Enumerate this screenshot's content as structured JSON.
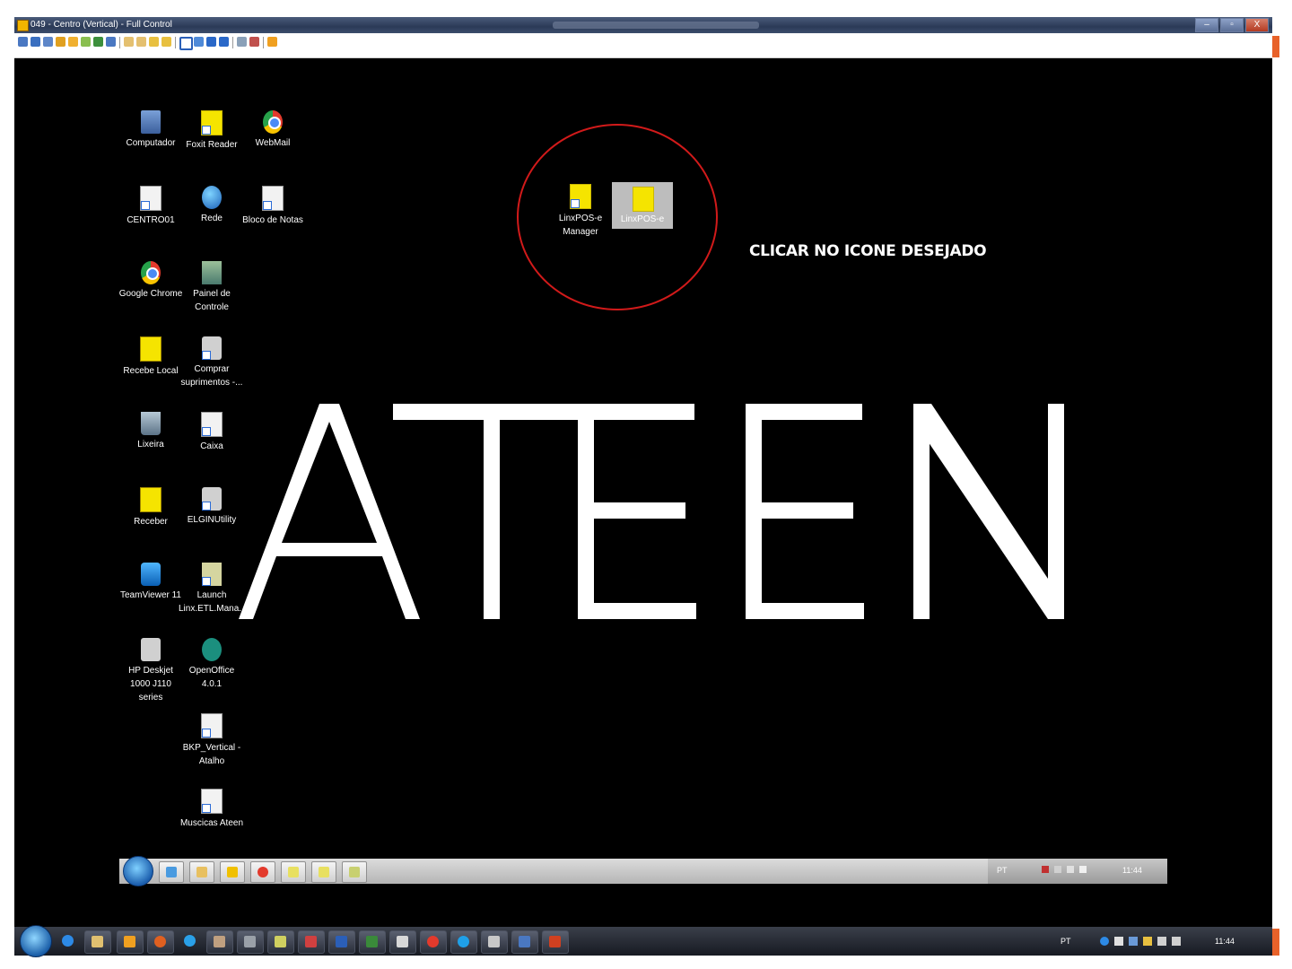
{
  "window": {
    "title": "049 - Centro (Vertical) - Full Control",
    "controls": {
      "minimize": "–",
      "maximize": "▫",
      "close": "X"
    }
  },
  "toolbar": {
    "buttons": [
      "pc",
      "monitor",
      "display",
      "arrows",
      "refresh",
      "transfer",
      "phone",
      "chat",
      "user1",
      "user2",
      "lock1",
      "lock2",
      "window",
      "screens",
      "blue1",
      "blue2",
      "gear",
      "tools",
      "close"
    ]
  },
  "desktop": {
    "icons": [
      {
        "label": "Computador",
        "icon": "computer-icon"
      },
      {
        "label": "Foxit Reader",
        "icon": "pdf-reader-icon"
      },
      {
        "label": "WebMail",
        "icon": "chrome-icon"
      },
      {
        "label": "CENTRO01",
        "icon": "file-icon"
      },
      {
        "label": "Rede",
        "icon": "network-icon"
      },
      {
        "label": "Bloco de Notas",
        "icon": "file-icon"
      },
      {
        "label": "Google Chrome",
        "icon": "chrome-icon"
      },
      {
        "label": "Painel de Controle",
        "icon": "control-panel-icon"
      },
      {
        "label": "Recebe Local",
        "icon": "rr-icon"
      },
      {
        "label": "Comprar suprimentos -...",
        "icon": "printer-icon"
      },
      {
        "label": "Lixeira",
        "icon": "recycle-bin-icon"
      },
      {
        "label": "Caixa",
        "icon": "file-icon"
      },
      {
        "label": "Receber",
        "icon": "rr-icon"
      },
      {
        "label": "ELGINUtility",
        "icon": "printer-icon"
      },
      {
        "label": "TeamViewer 11",
        "icon": "teamviewer-icon"
      },
      {
        "label": "Launch Linx.ETL.Mana...",
        "icon": "launch-icon"
      },
      {
        "label": "HP Deskjet 1000 J110 series",
        "icon": "printer-icon"
      },
      {
        "label": "OpenOffice 4.0.1",
        "icon": "openoffice-icon"
      },
      {
        "label": "BKP_Vertical - Atalho",
        "icon": "file-icon"
      },
      {
        "label": "Muscicas Ateen",
        "icon": "file-icon"
      }
    ],
    "highlighted": [
      {
        "label": "LinxPOS-e Manager",
        "icon": "linxpos-icon"
      },
      {
        "label": "LinxPOS-e",
        "icon": "linxpos-icon"
      }
    ],
    "instruction": "CLICAR NO ICONE DESEJADO",
    "wallpaper_text": "ATEEN",
    "accent_color": "#d11a1a"
  },
  "inner_taskbar": {
    "items": [
      "ie",
      "folder",
      "media",
      "chrome",
      "doc1",
      "doc2",
      "app"
    ],
    "tray": {
      "lang": "PT",
      "time": "11:44"
    }
  },
  "outer_taskbar": {
    "items": [
      "ie",
      "explorer",
      "app1",
      "firefox",
      "chrome",
      "app2",
      "app3",
      "app4",
      "shield",
      "word",
      "excel",
      "app5",
      "chrome2",
      "skype",
      "app6",
      "app7",
      "powerpoint"
    ],
    "tray": {
      "lang": "PT",
      "time": "11:44"
    }
  }
}
